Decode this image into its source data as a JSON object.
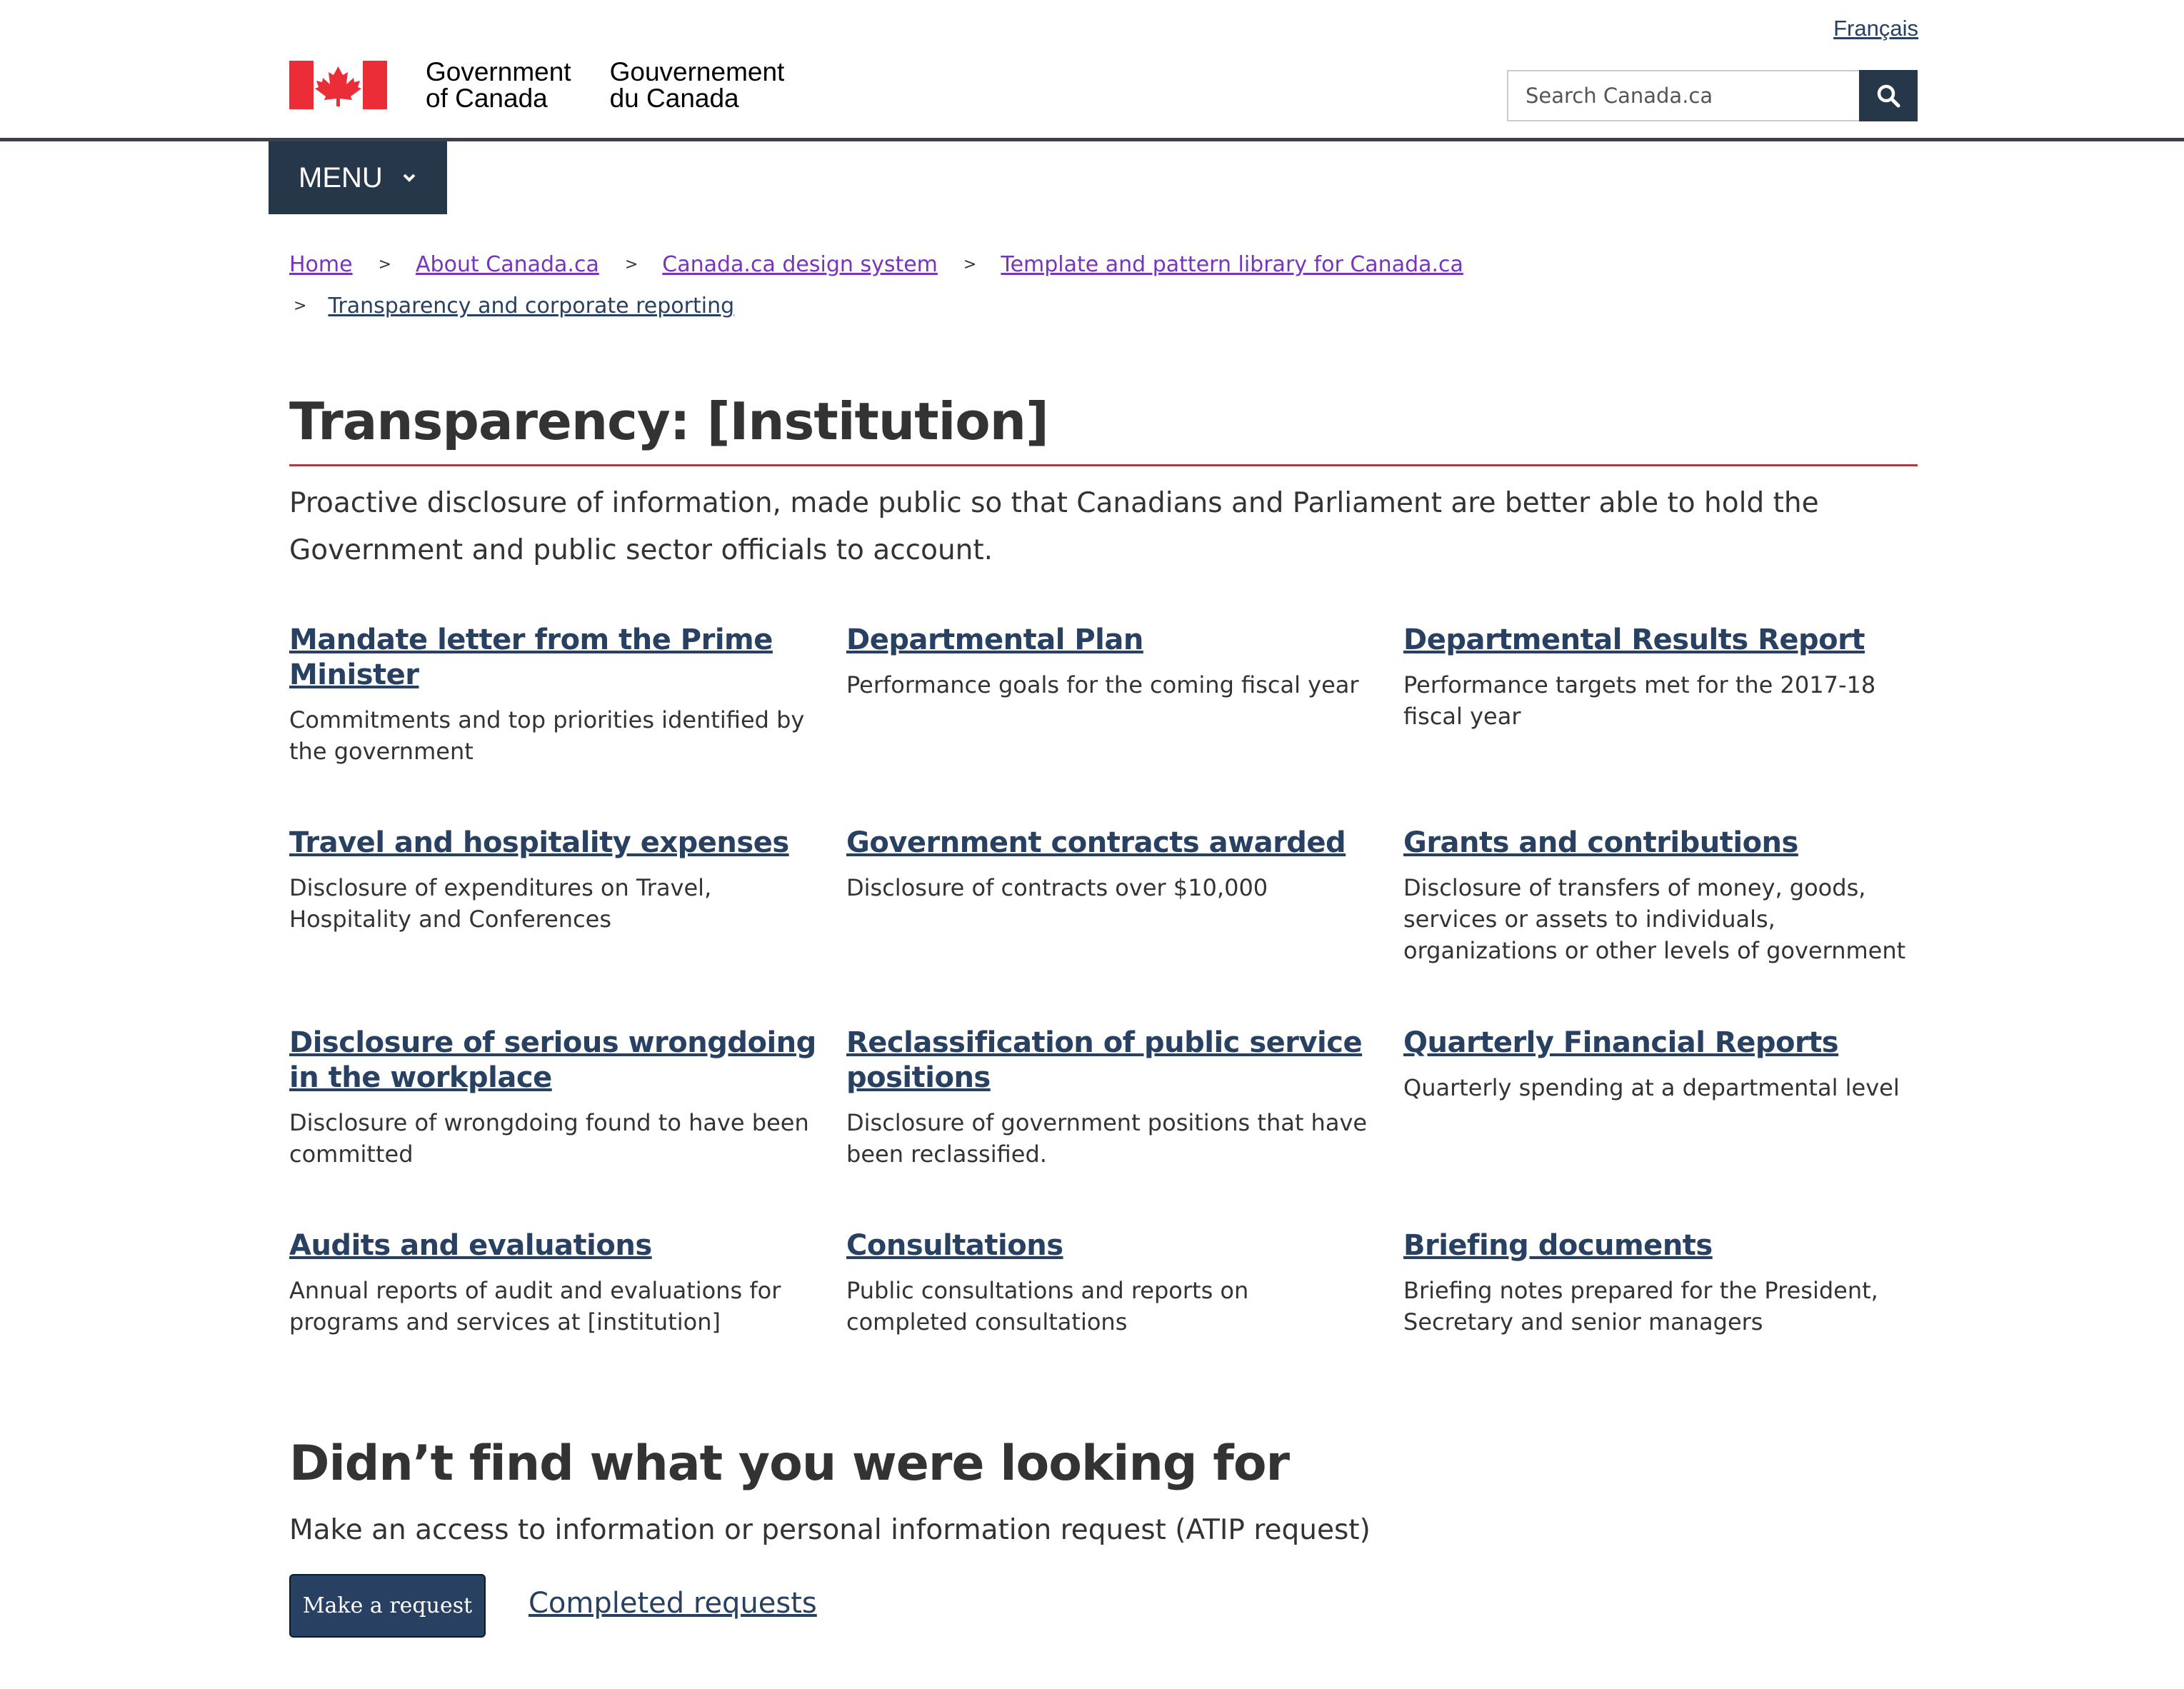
{
  "header": {
    "language_link": "Français",
    "signature_en": [
      "Government",
      "of Canada"
    ],
    "signature_fr": [
      "Gouvernement",
      "du Canada"
    ],
    "search_placeholder": "Search Canada.ca",
    "search_icon": "search-icon",
    "flag_icon": "canada-flag-icon",
    "accent_color": "#26374a"
  },
  "menu": {
    "label": "MENU",
    "icon": "chevron-down-icon"
  },
  "breadcrumb": [
    "Home",
    "About Canada.ca",
    "Canada.ca design system",
    "Template and pattern library for Canada.ca",
    "Transparency and corporate reporting"
  ],
  "main": {
    "title": "Transparency: [Institution]",
    "intro": "Proactive disclosure of information, made public so that Canadians and Parliament are better able to hold the Government and public sector officials to account.",
    "cards": [
      {
        "title": "Mandate letter from the Prime Minister",
        "desc": "Commitments and top priorities identified by the government"
      },
      {
        "title": "Departmental Plan",
        "desc": "Performance goals for the coming fiscal year"
      },
      {
        "title": "Departmental Results Report",
        "desc": "Performance targets met for the 2017-18 fiscal year"
      },
      {
        "title": "Travel and hospitality expenses",
        "desc": "Disclosure of expenditures on Travel, Hospitality and Conferences"
      },
      {
        "title": "Government contracts awarded",
        "desc": "Disclosure of contracts over $10,000"
      },
      {
        "title": "Grants and contributions",
        "desc": "Disclosure of transfers of money, goods, services or assets to individuals, organizations or other levels of government"
      },
      {
        "title": "Disclosure of serious wrongdoing in the workplace",
        "desc": "Disclosure of wrongdoing found to have been committed"
      },
      {
        "title": "Reclassification of public service positions",
        "desc": "Disclosure of government positions that have been reclassified."
      },
      {
        "title": "Quarterly Financial Reports",
        "desc": "Quarterly spending at a departmental level"
      },
      {
        "title": "Audits and evaluations",
        "desc": "Annual reports of audit and evaluations for programs and services at [institution]"
      },
      {
        "title": "Consultations",
        "desc": "Public consultations and reports on completed consultations"
      },
      {
        "title": "Briefing documents",
        "desc": "Briefing notes prepared for the President, Secretary and senior managers"
      }
    ]
  },
  "footer_section": {
    "heading": "Didn’t find what you were looking for",
    "text": "Make an access to information or personal information request (ATIP request)",
    "button_label": "Make a request",
    "link_label": "Completed requests"
  }
}
